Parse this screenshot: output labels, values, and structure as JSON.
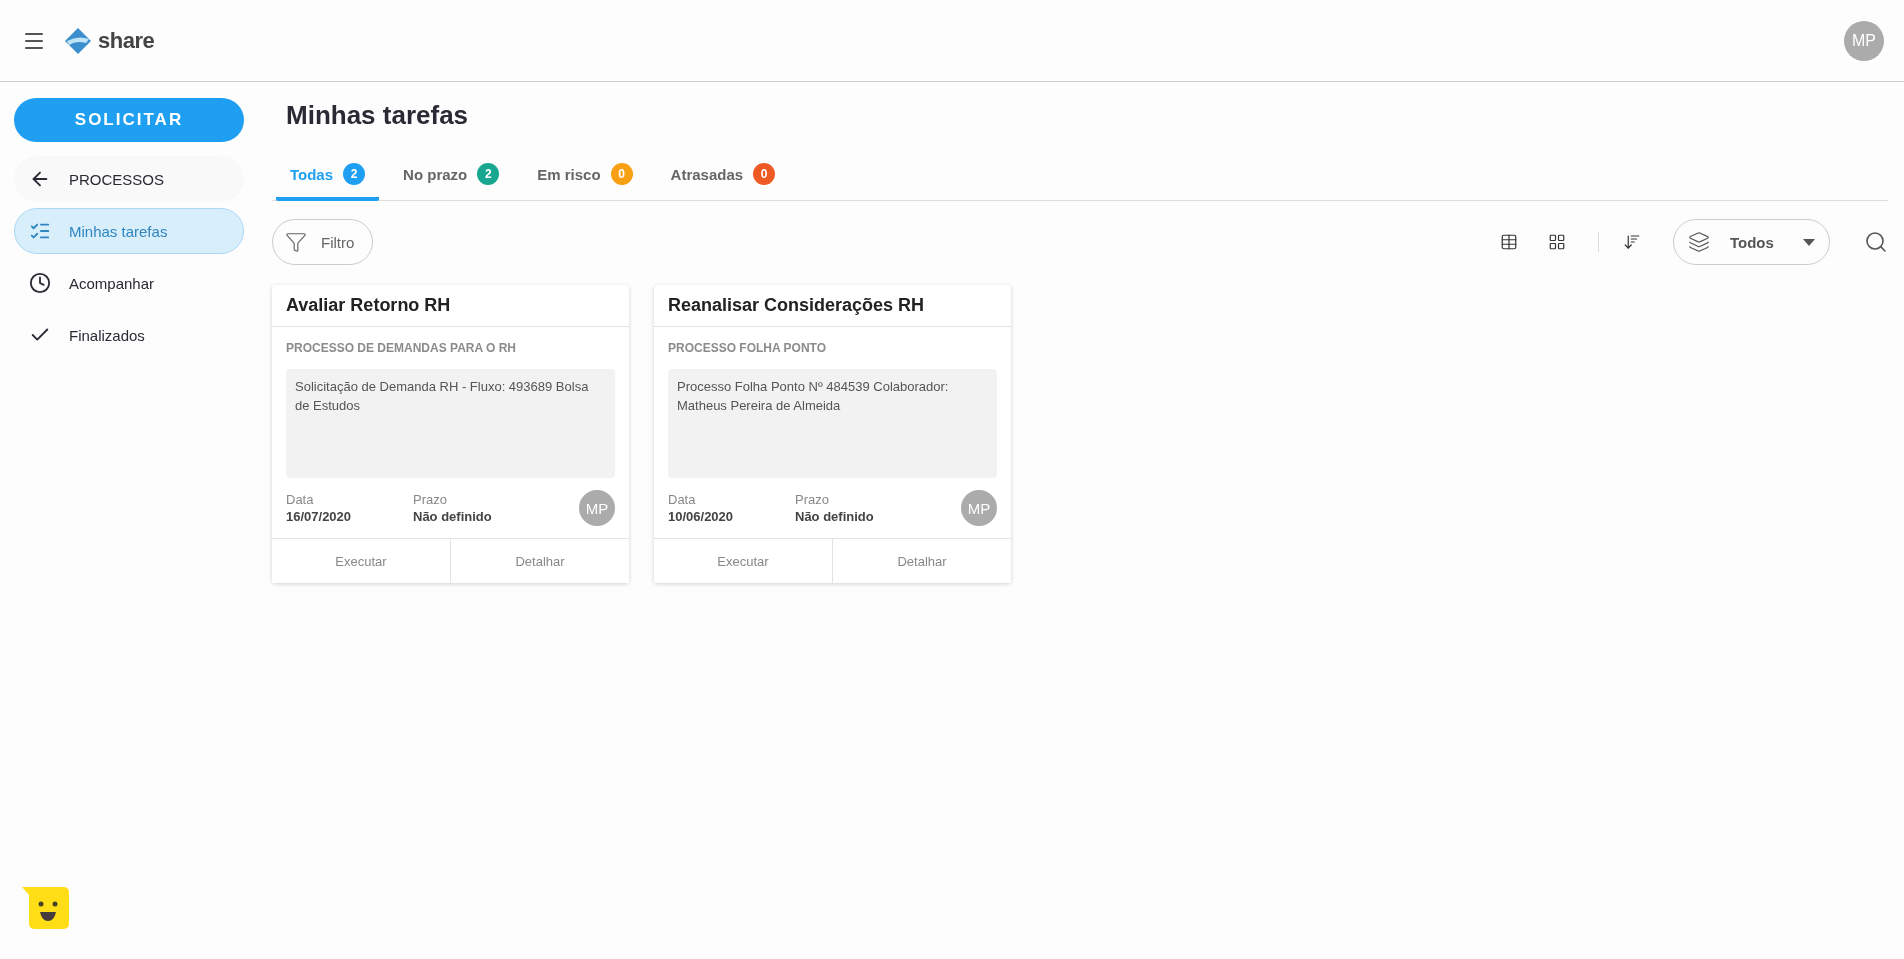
{
  "header": {
    "logo_text": "share",
    "avatar": "MP"
  },
  "sidebar": {
    "primary_button": "SOLICITAR",
    "back_item": {
      "label": "PROCESSOS"
    },
    "items": [
      {
        "label": "Minhas tarefas",
        "kind": "tasks",
        "selected": true
      },
      {
        "label": "Acompanhar",
        "kind": "clock",
        "selected": false
      },
      {
        "label": "Finalizados",
        "kind": "check",
        "selected": false
      }
    ]
  },
  "page_title": "Minhas tarefas",
  "tabs": [
    {
      "label": "Todas",
      "count": "2",
      "color": "#1e9ff2",
      "selected": true
    },
    {
      "label": "No prazo",
      "count": "2",
      "color": "#17a68f",
      "selected": false
    },
    {
      "label": "Em risco",
      "count": "0",
      "color": "#f7a014",
      "selected": false
    },
    {
      "label": "Atrasadas",
      "count": "0",
      "color": "#ee5a24",
      "selected": false
    }
  ],
  "toolbar": {
    "filter_button": "Filtro",
    "type_select": {
      "value": "Todos"
    }
  },
  "cards": [
    {
      "title": "Avaliar Retorno RH",
      "process": "PROCESSO DE DEMANDAS PARA O RH",
      "description": "Solicitação de Demanda RH - Fluxo: 493689 Bolsa de Estudos",
      "date_label": "Data",
      "date": "16/07/2020",
      "deadline_label": "Prazo",
      "deadline": "Não definido",
      "avatar": "MP",
      "actions": [
        "Executar",
        "Detalhar"
      ]
    },
    {
      "title": "Reanalisar Considerações RH",
      "process": "PROCESSO FOLHA PONTO",
      "description": "Processo Folha Ponto Nº 484539 Colaborador: Matheus Pereira de Almeida",
      "date_label": "Data",
      "date": "10/06/2020",
      "deadline_label": "Prazo",
      "deadline": "Não definido",
      "avatar": "MP",
      "actions": [
        "Executar",
        "Detalhar"
      ]
    }
  ]
}
